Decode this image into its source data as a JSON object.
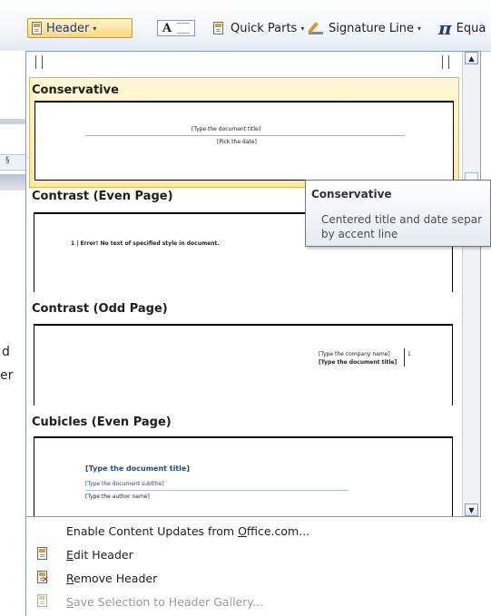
{
  "ribbon": {
    "header_label": "Header",
    "textbox_glyph": "A",
    "quick_parts_label": "Quick Parts",
    "signature_line_label": "Signature Line",
    "equation_label": "Equa",
    "dropdown_arrow": "▾",
    "pi_glyph": "π"
  },
  "background_doc": {
    "ruler_mark": "§",
    "text_d": "d",
    "text_er": "er"
  },
  "gallery": {
    "items": [
      {
        "name": "Conservative",
        "lines": [
          "[Type the document title]",
          "[Pick the date]"
        ]
      },
      {
        "name": "Contrast (Even Page)",
        "lines": [
          "1 | Error! No text of specified style in document."
        ]
      },
      {
        "name": "Contrast (Odd Page)",
        "lines": [
          "[Type the company name]",
          "1",
          "[Type the document title]"
        ]
      },
      {
        "name": "Cubicles (Even Page)",
        "lines": [
          "[Type the document title]",
          "[Type the document subtitle]",
          "[Type the author name]"
        ]
      }
    ],
    "scroll_up": "▲",
    "scroll_down": "▼"
  },
  "tooltip": {
    "title": "Conservative",
    "line1": "Centered title and date separ",
    "line2": "by accent line"
  },
  "menu": {
    "enable_updates": {
      "pre": "Enable Content Updates from ",
      "u": "O",
      "post": "ffice.com..."
    },
    "edit_header": {
      "u": "E",
      "post": "dit Header"
    },
    "remove_header": {
      "u": "R",
      "post": "emove Header"
    },
    "save_selection": {
      "u": "S",
      "post": "ave Selection to Header Gallery..."
    }
  },
  "colors": {
    "selected_bg": "#ffe9a4",
    "accent_title": "#1f4e8c",
    "tooltip_border": "#767676"
  }
}
